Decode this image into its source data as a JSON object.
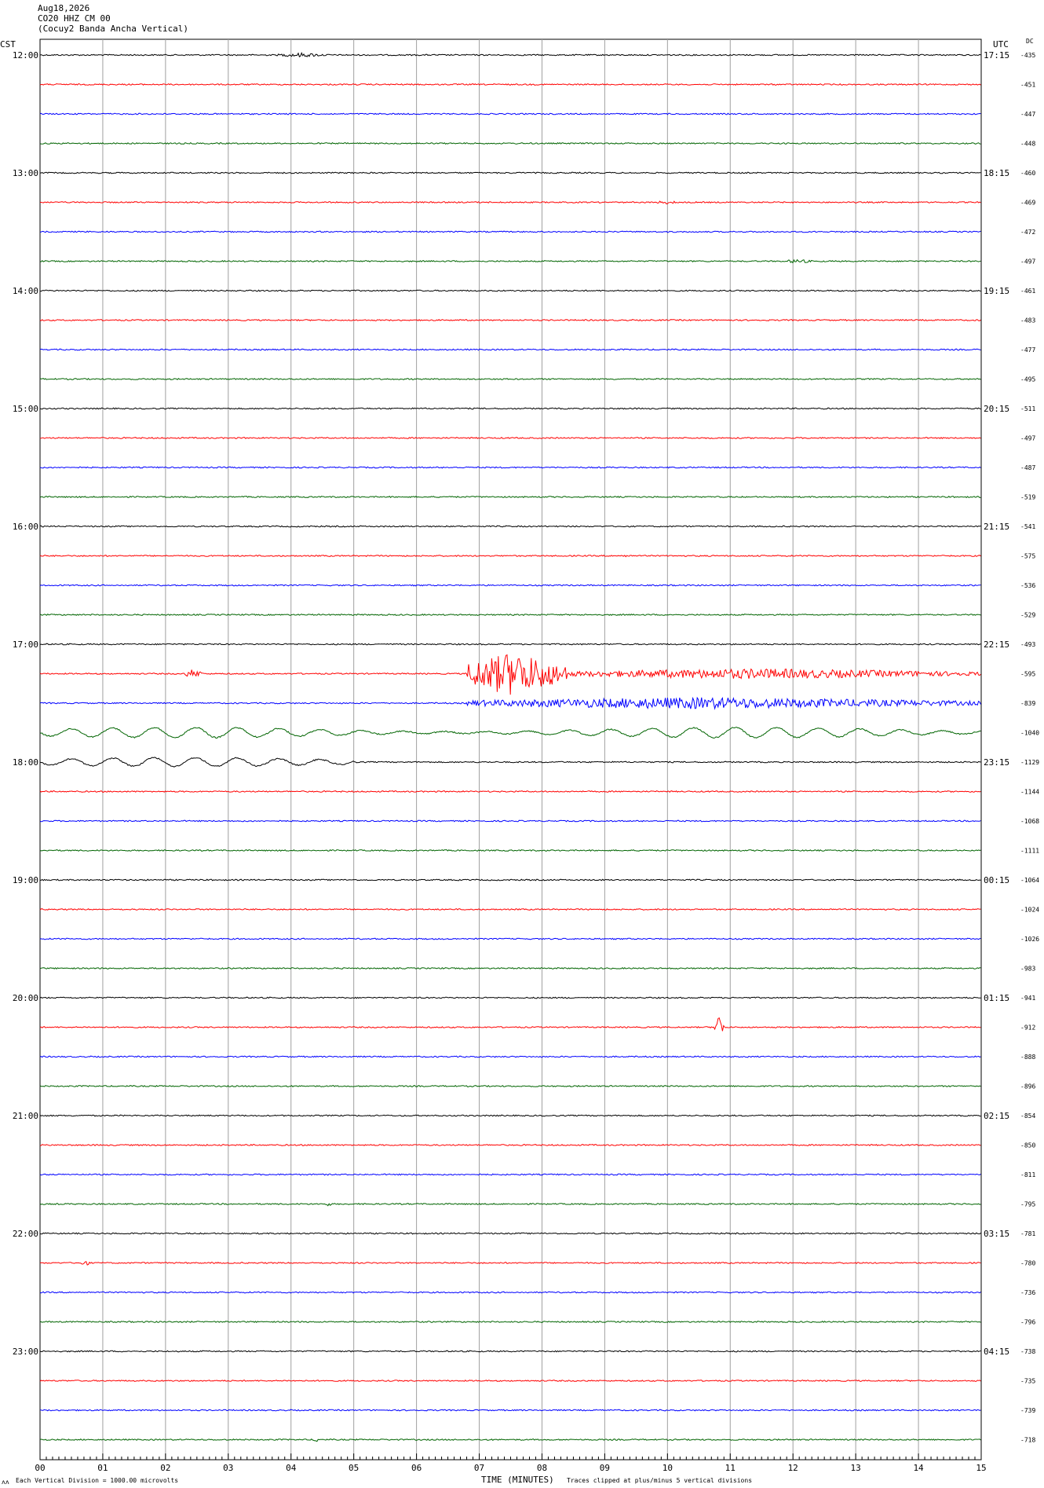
{
  "header": {
    "date": "Aug18,2026",
    "station": "CO20 HHZ CM 00",
    "description": "(Cocuy2 Banda Ancha Vertical)"
  },
  "left_label": "CST",
  "right_label": "UTC",
  "dc_label": "DC",
  "footer": {
    "scale_note": "Each Vertical Division = 1000.00 microvolts",
    "xlabel": "TIME (MINUTES)",
    "clip_note": "Traces clipped at plus/minus 5 vertical divisions",
    "logo_mark": "ʌʌ"
  },
  "colors": {
    "cycle": [
      "#000000",
      "#ff0000",
      "#0000ff",
      "#006400"
    ],
    "grid": "#a0a0a0"
  },
  "chart_data": {
    "type": "line",
    "title": "CO20 HHZ CM 00",
    "xlabel": "TIME (MINUTES)",
    "xlim": [
      0,
      15
    ],
    "x_ticks": [
      "00",
      "01",
      "02",
      "03",
      "04",
      "05",
      "06",
      "07",
      "08",
      "09",
      "10",
      "11",
      "12",
      "13",
      "14",
      "15"
    ],
    "left_hour_labels": [
      "12:00",
      "13:00",
      "14:00",
      "15:00",
      "16:00",
      "17:00",
      "18:00",
      "19:00",
      "20:00",
      "21:00",
      "22:00",
      "23:00"
    ],
    "right_hour_labels": [
      "17:15",
      "18:15",
      "19:15",
      "20:15",
      "21:15",
      "22:15",
      "23:15",
      "00:15",
      "01:15",
      "02:15",
      "03:15",
      "04:15"
    ],
    "dc_offsets": [
      -435,
      -451,
      -447,
      -448,
      -460,
      -469,
      -472,
      -497,
      -461,
      -483,
      -477,
      -495,
      -511,
      -497,
      -487,
      -519,
      -541,
      -575,
      -536,
      -529,
      -493,
      -595,
      -839,
      -1040,
      -1129,
      -1144,
      -1068,
      -1111,
      -1064,
      -1024,
      -1026,
      -983,
      -941,
      -912,
      -888,
      -896,
      -854,
      -850,
      -811,
      -795,
      -781,
      -780,
      -736,
      -796,
      -738,
      -735,
      -739,
      -718
    ],
    "events": [
      {
        "trace": 0,
        "start_min": 3.8,
        "end_min": 4.6,
        "amplitude_div": 0.15
      },
      {
        "trace": 5,
        "start_min": 9.8,
        "end_min": 10.2,
        "amplitude_div": 0.12
      },
      {
        "trace": 7,
        "start_min": 11.9,
        "end_min": 12.3,
        "amplitude_div": 0.15
      },
      {
        "trace": 17,
        "start_min": 9.3,
        "end_min": 9.4,
        "amplitude_div": 0.15
      },
      {
        "trace": 21,
        "start_min": 2.3,
        "end_min": 2.6,
        "amplitude_div": 0.3
      },
      {
        "trace": 21,
        "start_min": 6.8,
        "end_min": 8.4,
        "amplitude_div": 1.5
      },
      {
        "trace": 21,
        "start_min": 8.4,
        "end_min": 15.0,
        "amplitude_div": 0.35
      },
      {
        "trace": 22,
        "start_min": 6.8,
        "end_min": 15.0,
        "amplitude_div": 0.4
      },
      {
        "trace": 33,
        "start_min": 10.75,
        "end_min": 10.9,
        "amplitude_div": 0.9
      },
      {
        "trace": 39,
        "start_min": 4.55,
        "end_min": 4.65,
        "amplitude_div": 0.15
      },
      {
        "trace": 41,
        "start_min": 0.65,
        "end_min": 0.8,
        "amplitude_div": 0.2
      },
      {
        "trace": 47,
        "start_min": 4.35,
        "end_min": 4.45,
        "amplitude_div": 0.2
      }
    ],
    "long_period_waves": [
      {
        "trace": 23,
        "amplitude_div": 0.35
      },
      {
        "trace": 24,
        "start_min": 0,
        "end_min": 5,
        "amplitude_div": 0.3
      }
    ],
    "grid": true
  }
}
